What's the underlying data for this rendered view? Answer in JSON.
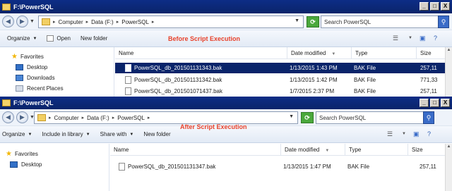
{
  "top_window": {
    "title": "F:\\PowerSQL",
    "controls": {
      "minimize": "_",
      "maximize": "□",
      "close": "X"
    },
    "address": {
      "crumbs": [
        "Computer",
        "Data (F:)",
        "PowerSQL"
      ]
    },
    "search": {
      "placeholder": "Search PowerSQL"
    },
    "toolbar": {
      "organize": "Organize",
      "open": "Open",
      "new_folder": "New folder"
    },
    "annotation": "Before Script Execution",
    "navigation": [
      "Favorites",
      "Desktop",
      "Downloads",
      "Recent Places"
    ],
    "columns": [
      "Name",
      "Date modified",
      "Type",
      "Size"
    ],
    "files": [
      {
        "name": "PowerSQL_db_201501131343.bak",
        "date": "1/13/2015 1:43 PM",
        "type": "BAK File",
        "size": "257,11",
        "selected": true
      },
      {
        "name": "PowerSQL_db_201501131342.bak",
        "date": "1/13/2015 1:42 PM",
        "type": "BAK File",
        "size": "771,33",
        "selected": false
      },
      {
        "name": "PowerSQL_db_201501071437.bak",
        "date": "1/7/2015 2:37 PM",
        "type": "BAK File",
        "size": "257,11",
        "selected": false
      }
    ]
  },
  "bottom_window": {
    "title": "F:\\PowerSQL",
    "controls": {
      "minimize": "_",
      "maximize": "□",
      "close": "X"
    },
    "address": {
      "crumbs": [
        "Computer",
        "Data (F:)",
        "PowerSQL"
      ]
    },
    "search": {
      "placeholder": "Search PowerSQL"
    },
    "toolbar": {
      "organize": "Organize",
      "include": "Include in library",
      "share": "Share with",
      "new_folder": "New folder"
    },
    "annotation": "After Script Execution",
    "navigation": [
      "Favorites",
      "Desktop"
    ],
    "columns": [
      "Name",
      "Date modified",
      "Type",
      "Size"
    ],
    "files": [
      {
        "name": "PowerSQL_db_201501131347.bak",
        "date": "1/13/2015 1:47 PM",
        "type": "BAK File",
        "size": "257,11",
        "selected": false
      }
    ]
  },
  "colors": {
    "titlebar": "#0a246a",
    "selection": "#0a246a",
    "annotation": "#e8422b"
  }
}
